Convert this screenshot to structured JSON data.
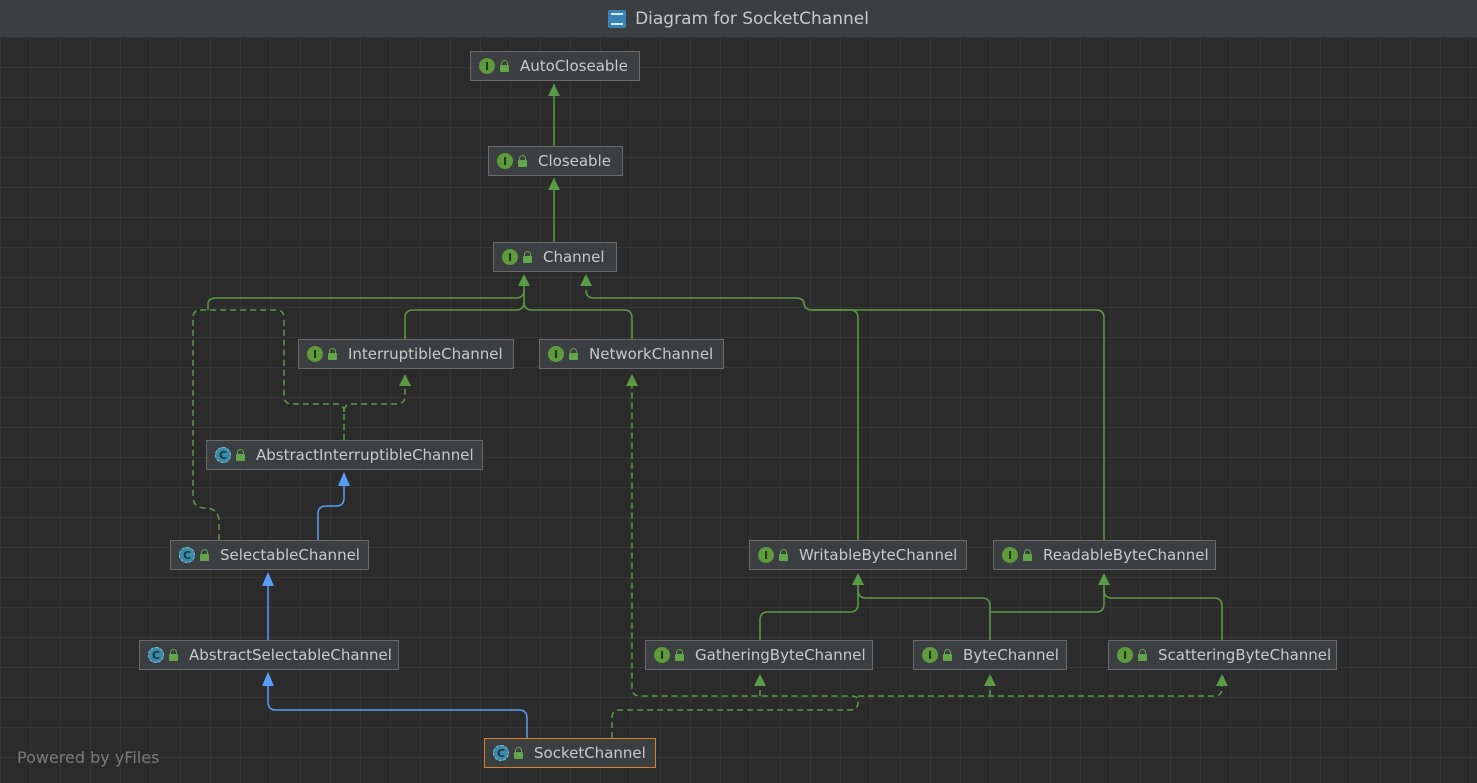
{
  "window": {
    "title": "Diagram for SocketChannel",
    "title_icon": "diagram-icon"
  },
  "colors": {
    "background": "#2b2b2b",
    "interface_edge": "#5b9b45",
    "class_edge": "#589df6",
    "selected_border": "#d87f2a"
  },
  "nodes": {
    "auto_closeable": {
      "label": "AutoCloseable",
      "kind": "interface",
      "badge": "I"
    },
    "closeable": {
      "label": "Closeable",
      "kind": "interface",
      "badge": "I"
    },
    "channel": {
      "label": "Channel",
      "kind": "interface",
      "badge": "I"
    },
    "interruptible_channel": {
      "label": "InterruptibleChannel",
      "kind": "interface",
      "badge": "I"
    },
    "network_channel": {
      "label": "NetworkChannel",
      "kind": "interface",
      "badge": "I"
    },
    "abstract_interruptible_channel": {
      "label": "AbstractInterruptibleChannel",
      "kind": "abstract-class",
      "badge": "C"
    },
    "selectable_channel": {
      "label": "SelectableChannel",
      "kind": "abstract-class",
      "badge": "C"
    },
    "abstract_selectable_channel": {
      "label": "AbstractSelectableChannel",
      "kind": "abstract-class",
      "badge": "C"
    },
    "socket_channel": {
      "label": "SocketChannel",
      "kind": "abstract-class",
      "badge": "C",
      "selected": true
    },
    "writable_byte_channel": {
      "label": "WritableByteChannel",
      "kind": "interface",
      "badge": "I"
    },
    "readable_byte_channel": {
      "label": "ReadableByteChannel",
      "kind": "interface",
      "badge": "I"
    },
    "gathering_byte_channel": {
      "label": "GatheringByteChannel",
      "kind": "interface",
      "badge": "I"
    },
    "byte_channel": {
      "label": "ByteChannel",
      "kind": "interface",
      "badge": "I"
    },
    "scattering_byte_channel": {
      "label": "ScatteringByteChannel",
      "kind": "interface",
      "badge": "I"
    }
  },
  "footer": {
    "text": "Powered by yFiles"
  }
}
